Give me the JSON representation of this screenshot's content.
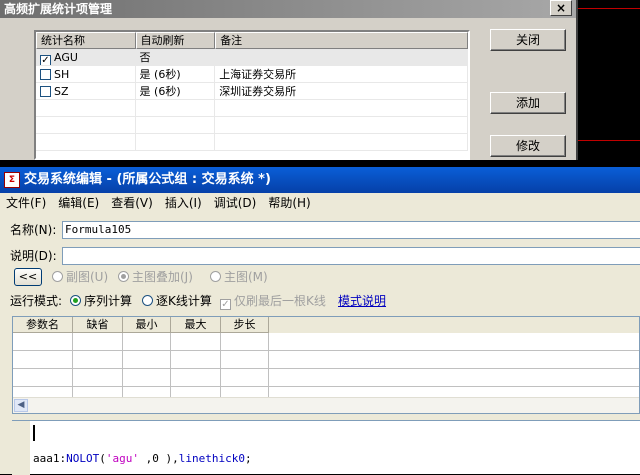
{
  "stats_dialog": {
    "title": "高频扩展统计项管理",
    "close_glyph": "×",
    "columns": [
      "统计名称",
      "自动刷新",
      "备注"
    ],
    "rows": [
      {
        "checked": true,
        "name": "AGU",
        "refresh": "否",
        "note": ""
      },
      {
        "checked": false,
        "name": "SH",
        "refresh": "是 (6秒)",
        "note": "上海证券交易所"
      },
      {
        "checked": false,
        "name": "SZ",
        "refresh": "是 (6秒)",
        "note": "深圳证券交易所"
      }
    ],
    "buttons": {
      "close": "关闭",
      "add": "添加",
      "edit": "修改"
    }
  },
  "editor": {
    "title": "交易系统编辑 - (所属公式组 : 交易系统 *)",
    "menu": [
      "文件(F)",
      "编辑(E)",
      "查看(V)",
      "插入(I)",
      "调试(D)",
      "帮助(H)"
    ],
    "name_label": "名称(N):",
    "name_value": "Formula105",
    "desc_label": "说明(D):",
    "desc_value": "",
    "collapse_label": "<<",
    "view_options": {
      "sub_chart": "副图(U)",
      "main_overlay": "主图叠加(J)",
      "main_chart": "主图(M)"
    },
    "run_mode_label": "运行模式:",
    "run_modes": {
      "sequential": "序列计算",
      "per_bar": "逐K线计算",
      "refresh_last": "仅刷最后一根K线"
    },
    "mode_help_link": "模式说明",
    "param_columns": [
      "参数名",
      "缺省",
      "最小",
      "最大",
      "步长"
    ],
    "code": {
      "prefix": "aaa1:",
      "fn": "NOLOT",
      "args_open": "(",
      "str": "'agu'",
      "args_rest": " ,0 ),",
      "kw": "linethick0",
      "end": ";"
    },
    "colors": {
      "titlebar": "#0a5fd8",
      "checked_radio": "#21a121",
      "link": "#0000c0"
    }
  }
}
